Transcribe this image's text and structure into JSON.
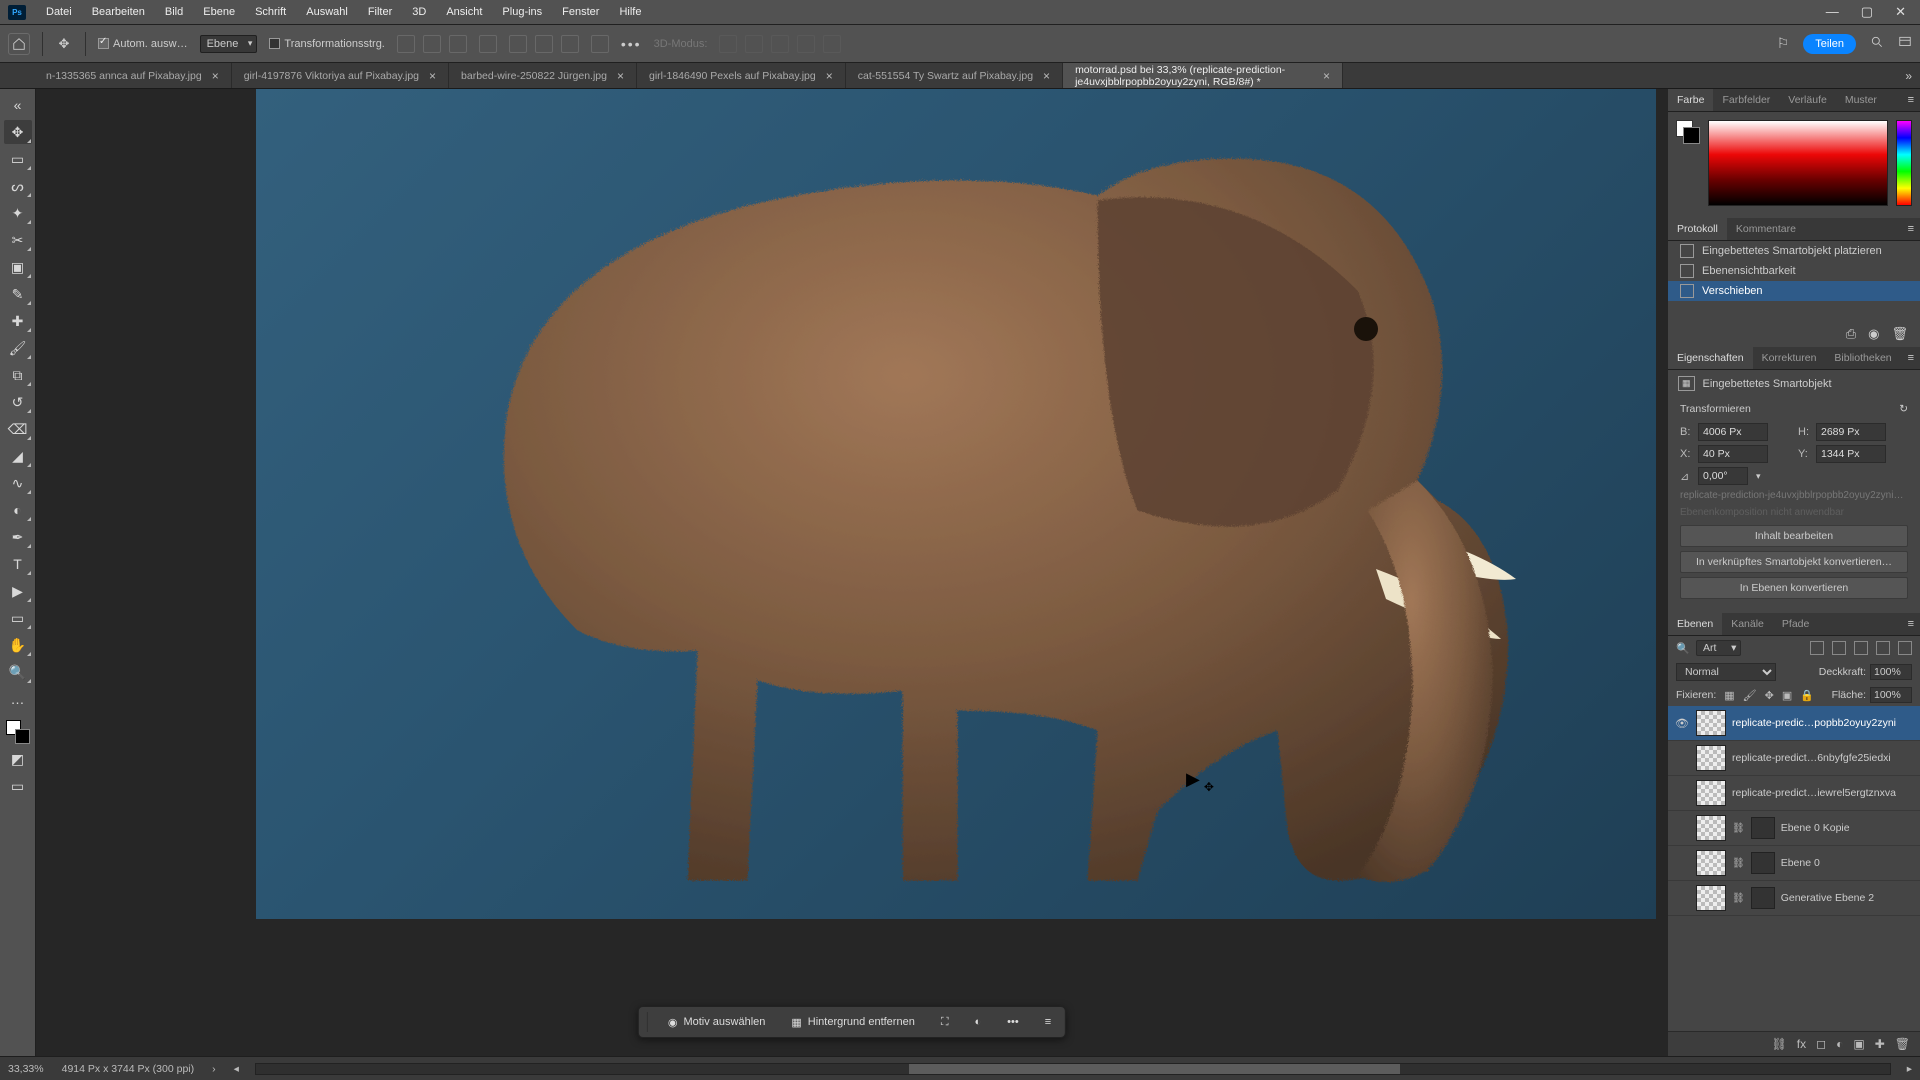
{
  "menu": [
    "Datei",
    "Bearbeiten",
    "Bild",
    "Ebene",
    "Schrift",
    "Auswahl",
    "Filter",
    "3D",
    "Ansicht",
    "Plug-ins",
    "Fenster",
    "Hilfe"
  ],
  "options": {
    "auto_select_label": "Autom. ausw…",
    "target_sel": "Ebene",
    "transform_label": "Transformationsstrg.",
    "threeDMode": "3D-Modus:"
  },
  "share_label": "Teilen",
  "tabs": [
    {
      "label": "n-1335365 annca auf Pixabay.jpg",
      "active": false
    },
    {
      "label": "girl-4197876 Viktoriya auf Pixabay.jpg",
      "active": false
    },
    {
      "label": "barbed-wire-250822 Jürgen.jpg",
      "active": false
    },
    {
      "label": "girl-1846490 Pexels auf Pixabay.jpg",
      "active": false
    },
    {
      "label": "cat-551554 Ty Swartz auf Pixabay.jpg",
      "active": false
    },
    {
      "label": "motorrad.psd bei 33,3% (replicate-prediction-je4uvxjbblrpopbb2oyuy2zyni, RGB/8#) *",
      "active": true
    }
  ],
  "floatbar": {
    "select_subject": "Motiv auswählen",
    "remove_bg": "Hintergrund entfernen"
  },
  "panels": {
    "color_tabs": [
      "Farbe",
      "Farbfelder",
      "Verläufe",
      "Muster"
    ],
    "history_tabs": [
      "Protokoll",
      "Kommentare"
    ],
    "history": [
      {
        "label": "Eingebettetes Smartobjekt platzieren"
      },
      {
        "label": "Ebenensichtbarkeit"
      },
      {
        "label": "Verschieben"
      }
    ],
    "props_tabs": [
      "Eigenschaften",
      "Korrekturen",
      "Bibliotheken"
    ],
    "props": {
      "type": "Eingebettetes Smartobjekt",
      "transform_title": "Transformieren",
      "B": "4006 Px",
      "H": "2689 Px",
      "X": "40 Px",
      "Y": "1344 Px",
      "rot": "0,00°",
      "srcname": "replicate-prediction-je4uvxjbblrpopbb2oyuy2zyni…",
      "comp_hint": "Ebenenkomposition nicht anwendbar",
      "btn_edit": "Inhalt bearbeiten",
      "btn_link": "In verknüpftes Smartobjekt konvertieren…",
      "btn_layers": "In Ebenen konvertieren"
    },
    "layers_tabs": [
      "Ebenen",
      "Kanäle",
      "Pfade"
    ],
    "layers": {
      "kind": "Art",
      "blend": "Normal",
      "opacity_label": "Deckkraft:",
      "opacity": "100%",
      "lock_label": "Fixieren:",
      "fill_label": "Fläche:",
      "fill": "100%",
      "items": [
        {
          "name": "replicate-predic…popbb2oyuy2zyni",
          "visible": true,
          "selected": true,
          "mask": false
        },
        {
          "name": "replicate-predict…6nbyfgfe25iedxi",
          "visible": false,
          "selected": false,
          "mask": false
        },
        {
          "name": "replicate-predict…iewrel5ergtznxva",
          "visible": false,
          "selected": false,
          "mask": false
        },
        {
          "name": "Ebene 0 Kopie",
          "visible": false,
          "selected": false,
          "mask": true
        },
        {
          "name": "Ebene 0",
          "visible": false,
          "selected": false,
          "mask": true
        },
        {
          "name": "Generative Ebene 2",
          "visible": false,
          "selected": false,
          "mask": true
        }
      ]
    }
  },
  "status": {
    "zoom": "33,33%",
    "doc": "4914 Px x 3744 Px (300 ppi)"
  }
}
